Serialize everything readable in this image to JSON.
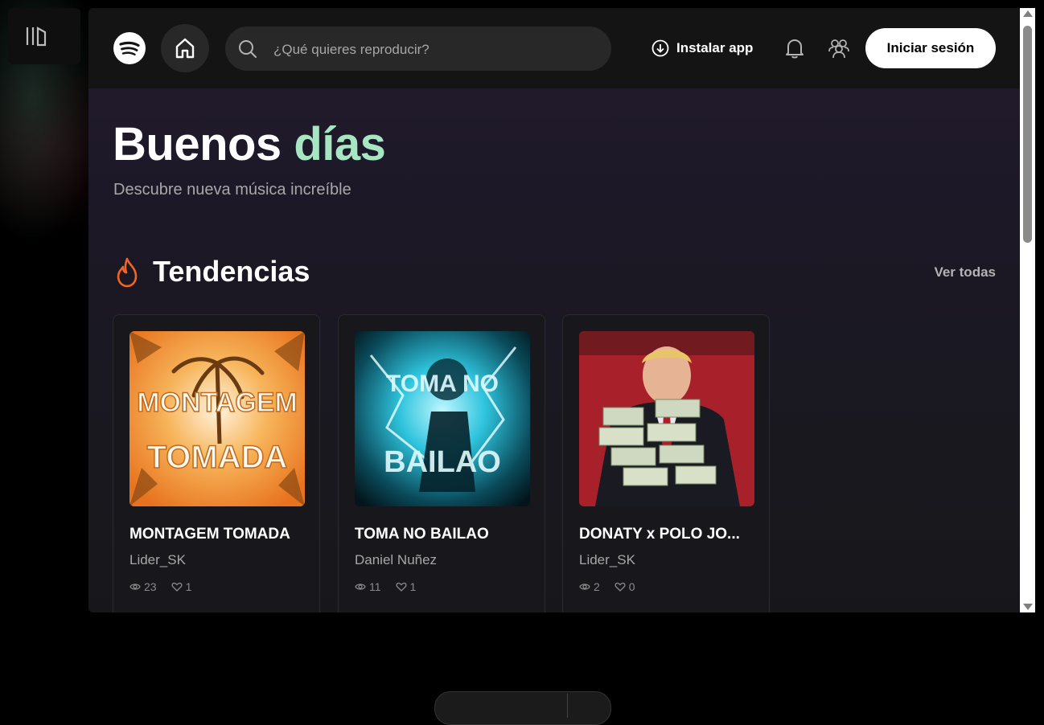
{
  "header": {
    "search_placeholder": "¿Qué quieres reproducir?",
    "install_label": "Instalar app",
    "login_label": "Iniciar sesión"
  },
  "hero": {
    "greeting_word1": "Buenos",
    "greeting_word2": "días",
    "subtitle": "Descubre nueva música increíble"
  },
  "trending": {
    "title": "Tendencias",
    "see_all": "Ver todas",
    "cards": [
      {
        "title": "MONTAGEM TOMADA",
        "artist": "Lider_SK",
        "views": "23",
        "likes": "1",
        "art_text": "MONTAGEM TOMADA"
      },
      {
        "title": "TOMA NO BAILAO",
        "artist": "Daniel Nuñez",
        "views": "11",
        "likes": "1",
        "art_text": "TOMA NO BAILAO"
      },
      {
        "title": "DONATY x POLO JO...",
        "artist": "Lider_SK",
        "views": "2",
        "likes": "0"
      }
    ]
  },
  "colors": {
    "accent_green": "#a8e6c3",
    "flame_orange": "#f26522",
    "brand": "#1ed760"
  },
  "icons": [
    "library-icon",
    "spotify-logo",
    "home-icon",
    "search-icon",
    "download-icon",
    "bell-icon",
    "friends-icon",
    "flame-icon",
    "eye-icon",
    "heart-icon"
  ]
}
